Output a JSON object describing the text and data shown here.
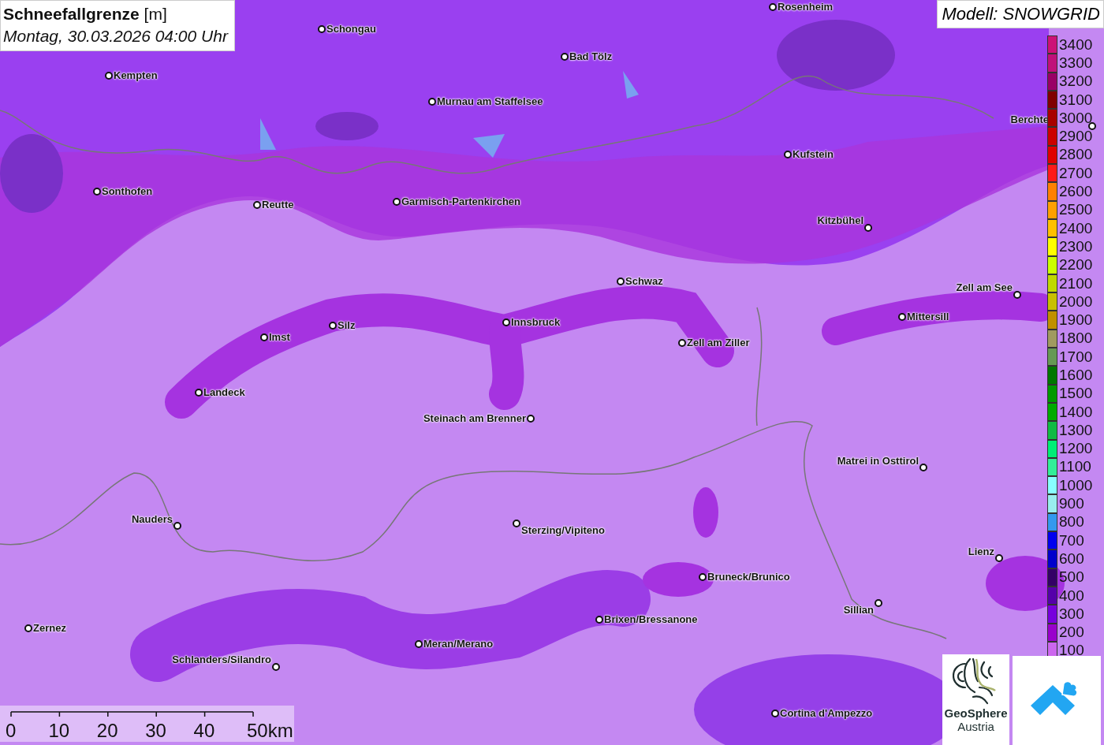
{
  "title": {
    "heading": "**Schneefallgrenze** [m]",
    "datetime": "Montag, 30.03.2026 04:00 Uhr"
  },
  "model": "Modell: SNOWGRID",
  "cities": [
    {
      "name": "Rosenheim"
    },
    {
      "name": "Schongau"
    },
    {
      "name": "Bad Tölz"
    },
    {
      "name": "Kempten"
    },
    {
      "name": "Murnau am Staffelsee"
    },
    {
      "name": "Berchte"
    },
    {
      "name": "Kufstein"
    },
    {
      "name": "Sonthofen"
    },
    {
      "name": "Garmisch-Partenkirchen"
    },
    {
      "name": "Reutte"
    },
    {
      "name": "Kitzbühel"
    },
    {
      "name": "Schwaz"
    },
    {
      "name": "Zell am See"
    },
    {
      "name": "Mittersill"
    },
    {
      "name": "Innsbruck"
    },
    {
      "name": "Silz"
    },
    {
      "name": "Imst"
    },
    {
      "name": "Zell am Ziller"
    },
    {
      "name": "Landeck"
    },
    {
      "name": "Steinach am Brenner"
    },
    {
      "name": "Matrei in Osttirol"
    },
    {
      "name": "Nauders"
    },
    {
      "name": "Sterzing/Vipiteno"
    },
    {
      "name": "Lienz"
    },
    {
      "name": "Bruneck/Brunico"
    },
    {
      "name": "Sillian"
    },
    {
      "name": "Brixen/Bressanone"
    },
    {
      "name": "Zernez"
    },
    {
      "name": "Meran/Merano"
    },
    {
      "name": "Schlanders/Silandro"
    },
    {
      "name": "Cortina d'Ampezzo"
    }
  ],
  "legend": [
    {
      "label": "3400",
      "color": "#cc1177"
    },
    {
      "label": "3300",
      "color": "#c0107a"
    },
    {
      "label": "3200",
      "color": "#990066"
    },
    {
      "label": "3100",
      "color": "#800000"
    },
    {
      "label": "3000",
      "color": "#a80000"
    },
    {
      "label": "2900",
      "color": "#cc0000"
    },
    {
      "label": "2800",
      "color": "#e00000"
    },
    {
      "label": "2700",
      "color": "#ff1a1a"
    },
    {
      "label": "2600",
      "color": "#ff8000"
    },
    {
      "label": "2500",
      "color": "#ffa000"
    },
    {
      "label": "2400",
      "color": "#ffc000"
    },
    {
      "label": "2300",
      "color": "#ffff00"
    },
    {
      "label": "2200",
      "color": "#ccff00"
    },
    {
      "label": "2100",
      "color": "#c0d800"
    },
    {
      "label": "2000",
      "color": "#c8c000"
    },
    {
      "label": "1900",
      "color": "#c09000"
    },
    {
      "label": "1800",
      "color": "#a09a60"
    },
    {
      "label": "1700",
      "color": "#669955"
    },
    {
      "label": "1600",
      "color": "#007700"
    },
    {
      "label": "1500",
      "color": "#009900"
    },
    {
      "label": "1400",
      "color": "#00aa00"
    },
    {
      "label": "1300",
      "color": "#11bb44"
    },
    {
      "label": "1200",
      "color": "#00ee77"
    },
    {
      "label": "1100",
      "color": "#33ee99"
    },
    {
      "label": "1000",
      "color": "#88ffff"
    },
    {
      "label": "900",
      "color": "#99eeee"
    },
    {
      "label": "800",
      "color": "#3399ee"
    },
    {
      "label": "700",
      "color": "#0000ee"
    },
    {
      "label": "600",
      "color": "#0000cc"
    },
    {
      "label": "500",
      "color": "#330066"
    },
    {
      "label": "400",
      "color": "#5500aa"
    },
    {
      "label": "300",
      "color": "#7700dd"
    },
    {
      "label": "200",
      "color": "#9900cc"
    },
    {
      "label": "100",
      "color": "#cc66ee"
    }
  ],
  "scale_bar": {
    "ticks": [
      "0",
      "10",
      "20",
      "30",
      "40",
      "50km"
    ]
  },
  "logos": {
    "geosphere": {
      "line1": "GeoSphere",
      "line2": "Austria"
    }
  }
}
